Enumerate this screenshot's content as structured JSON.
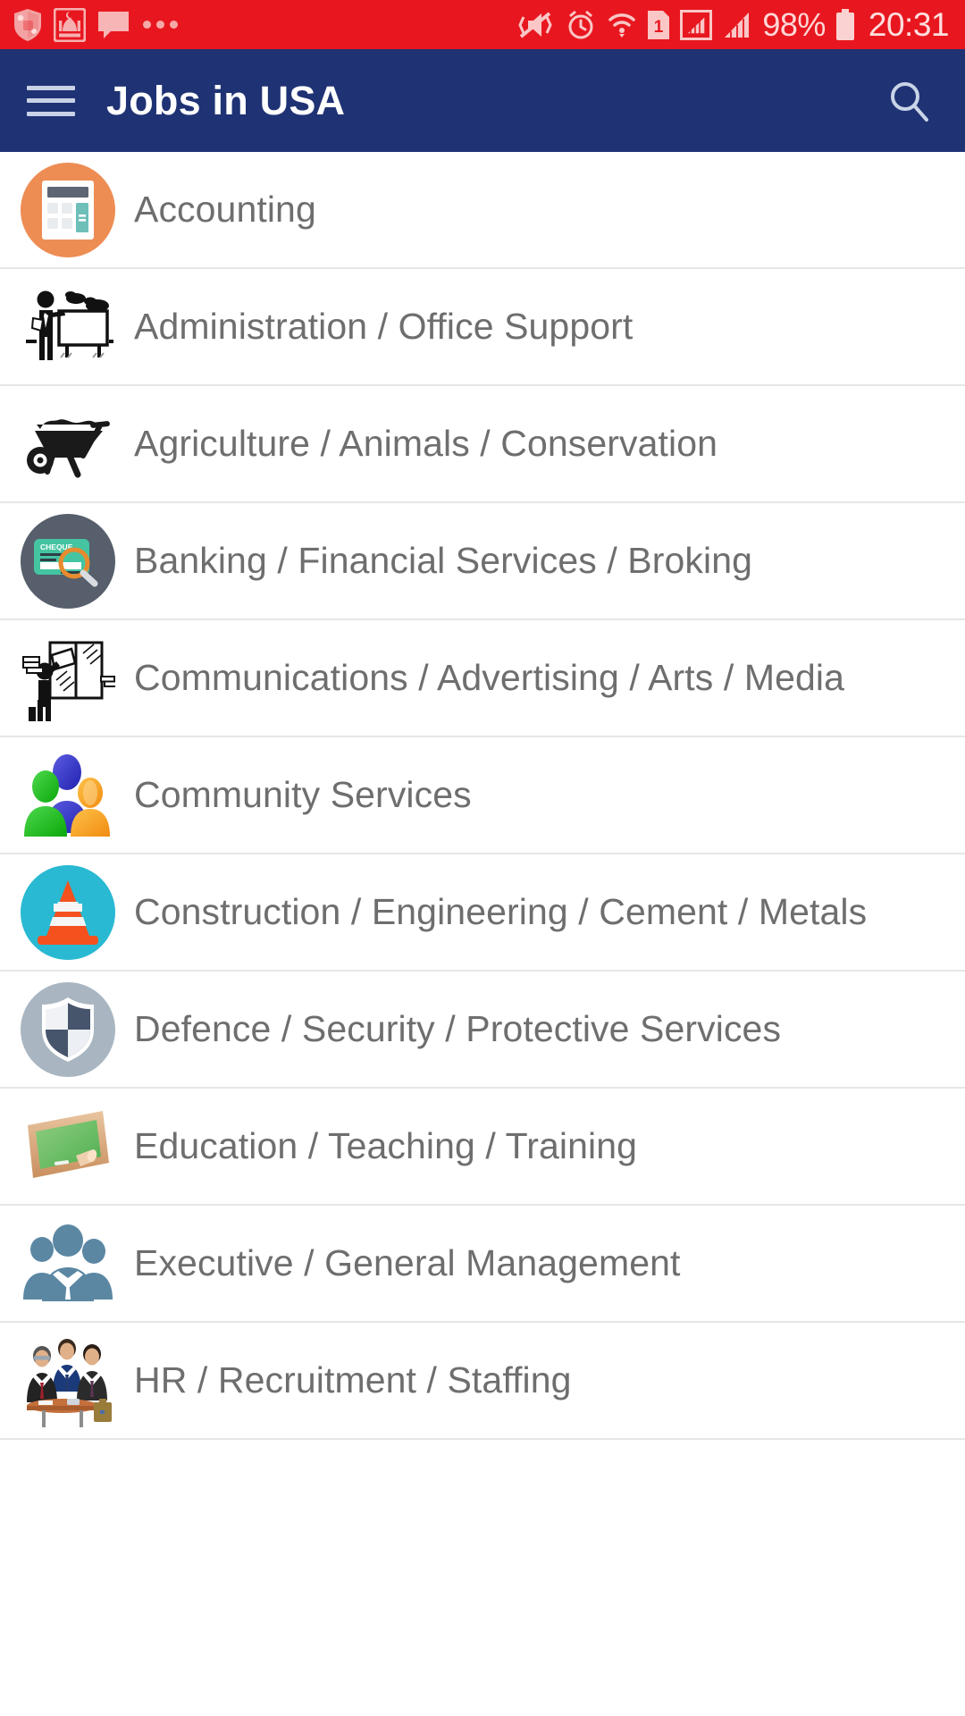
{
  "statusbar": {
    "time": "20:31",
    "battery_percent": "98%",
    "left_icons": [
      "shield-antivirus-icon",
      "mosque-prayer-icon",
      "message-bubble-icon",
      "more-notifications-dots"
    ],
    "right_icons": [
      "vibrate-mute-icon",
      "alarm-clock-icon",
      "wifi-icon",
      "sim-1-icon",
      "signal-boxed-icon",
      "signal-bars-icon",
      "battery-icon"
    ],
    "background_color": "#e8171f"
  },
  "appbar": {
    "menu_icon": "hamburger-menu-icon",
    "title": "Jobs in USA",
    "search_icon": "search-icon",
    "background_color": "#1f3274"
  },
  "list": {
    "items": [
      {
        "label": "Accounting",
        "icon": "calculator-icon",
        "icon_style": "circle-orange"
      },
      {
        "label": "Administration / Office Support",
        "icon": "presenter-board-icon",
        "icon_style": "flat-black"
      },
      {
        "label": "Agriculture / Animals / Conservation",
        "icon": "wheelbarrow-icon",
        "icon_style": "flat-black"
      },
      {
        "label": "Banking / Financial Services / Broking",
        "icon": "cheque-magnifier-icon",
        "icon_style": "circle-slate"
      },
      {
        "label": "Communications / Advertising / Arts / Media",
        "icon": "poster-billboard-icon",
        "icon_style": "flat-black"
      },
      {
        "label": "Community Services",
        "icon": "people-group-color-icon",
        "icon_style": "flat-color"
      },
      {
        "label": "Construction / Engineering / Cement / Metals",
        "icon": "traffic-cone-icon",
        "icon_style": "circle-cyan"
      },
      {
        "label": "Defence / Security / Protective Services",
        "icon": "shield-icon",
        "icon_style": "circle-gray"
      },
      {
        "label": "Education / Teaching / Training",
        "icon": "chalkboard-icon",
        "icon_style": "flat-color"
      },
      {
        "label": "Executive / General Management",
        "icon": "business-team-icon",
        "icon_style": "flat-color"
      },
      {
        "label": "HR / Recruitment / Staffing",
        "icon": "interview-panel-icon",
        "icon_style": "flat-color"
      }
    ]
  },
  "colors": {
    "status_red": "#e8171f",
    "appbar_navy": "#1f3274",
    "text_gray": "#6e6e6e",
    "divider": "#e6e6e6",
    "accent_orange": "#ed8d54",
    "accent_cyan": "#29b9d3",
    "accent_slate": "#565f6b"
  }
}
